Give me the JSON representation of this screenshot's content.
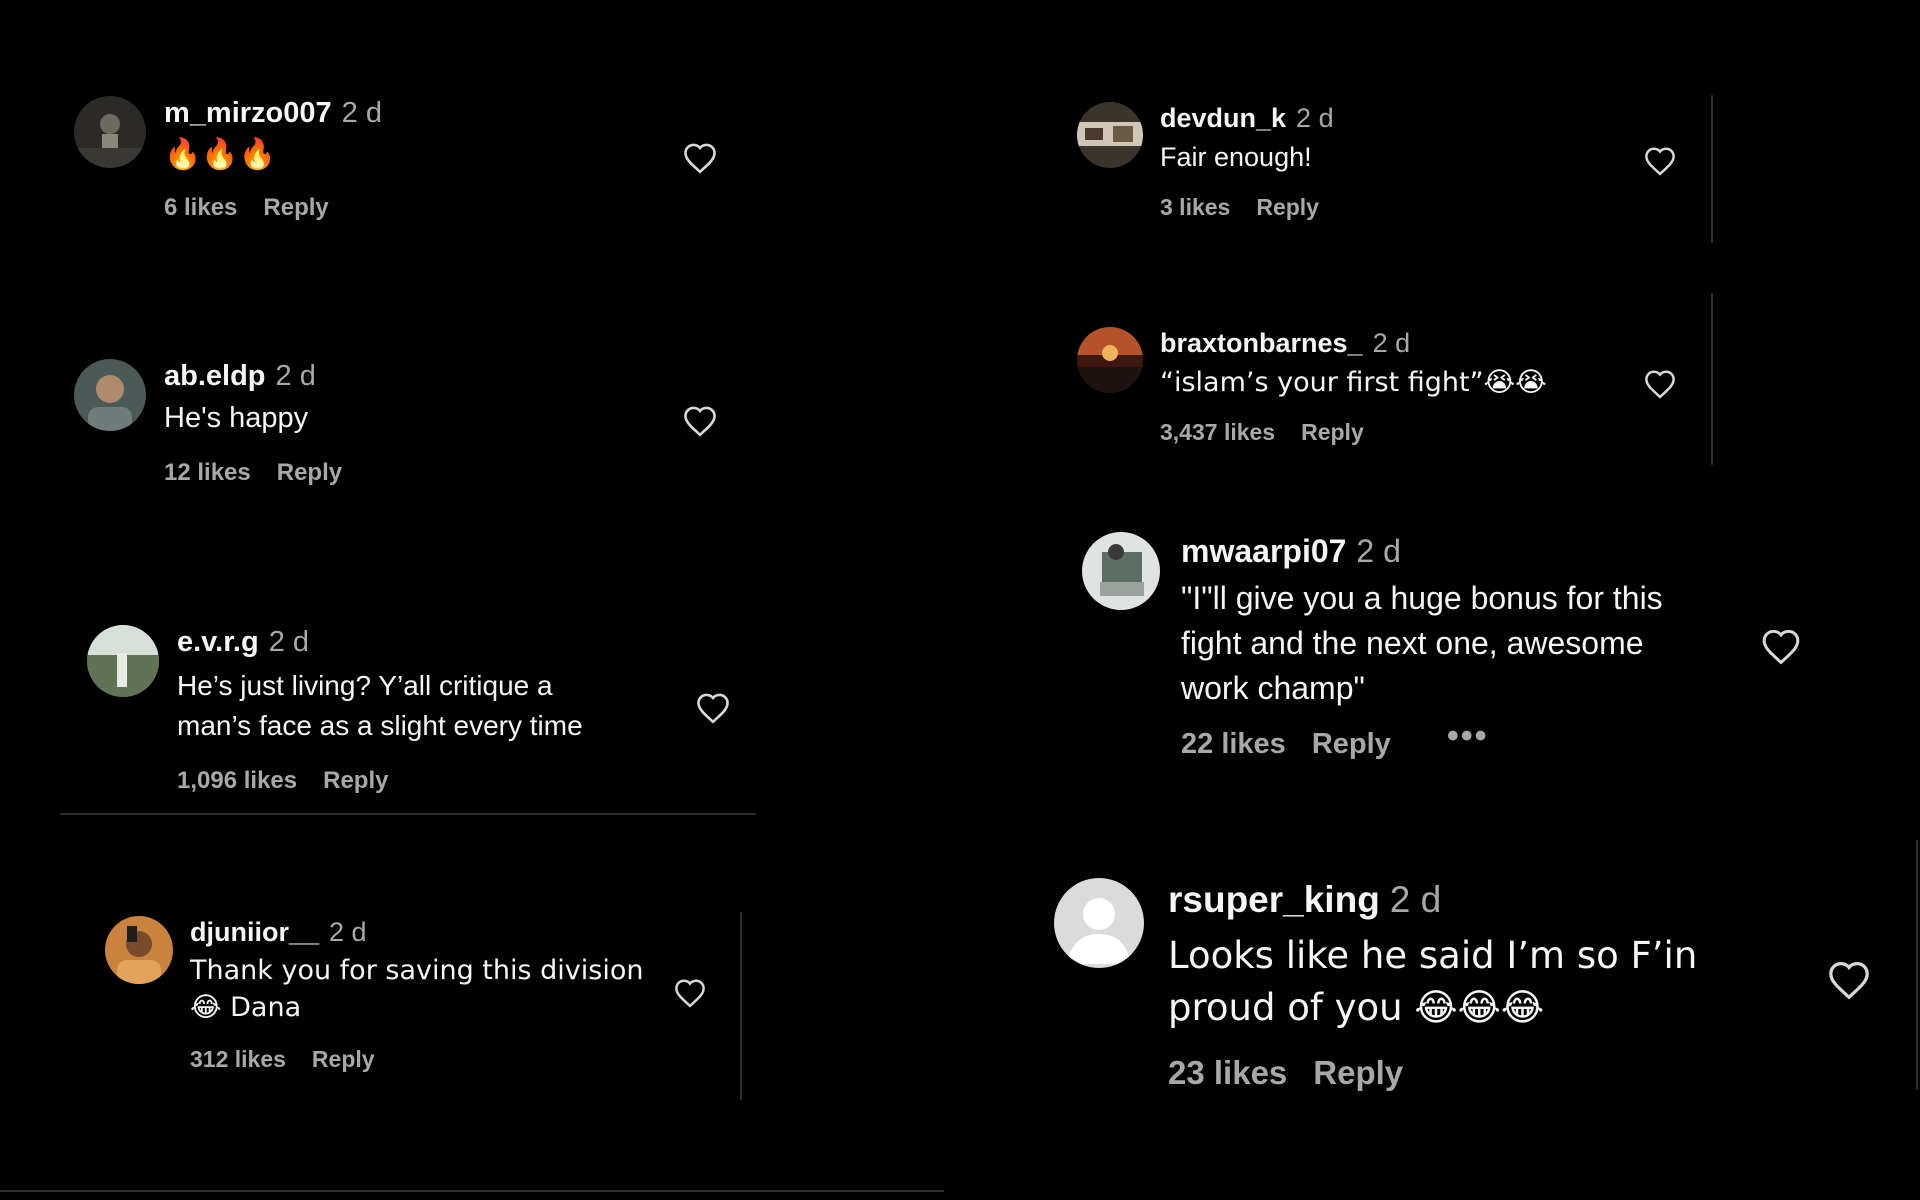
{
  "colors": {
    "background": "#000000",
    "text_primary": "#f5f5f5",
    "text_secondary": "#a8a8a8",
    "divider": "#2e2e2e"
  },
  "comments": [
    {
      "username": "m_mirzo007",
      "time": "2 d",
      "text": "🔥🔥🔥",
      "likes": "6 likes",
      "reply": "Reply",
      "like_icon": "heart-outline-icon"
    },
    {
      "username": "ab.eldp",
      "time": "2 d",
      "text": "He's happy",
      "likes": "12 likes",
      "reply": "Reply",
      "like_icon": "heart-outline-icon"
    },
    {
      "username": "e.v.r.g",
      "time": "2 d",
      "text_lines": [
        "He’s just living? Y’all critique a",
        "man’s face as a slight every time"
      ],
      "likes": "1,096 likes",
      "reply": "Reply",
      "like_icon": "heart-outline-icon"
    },
    {
      "username": "djuniior__",
      "time": "2 d",
      "text_lines": [
        "Thank you for saving this division",
        "😂 Dana"
      ],
      "likes": "312 likes",
      "reply": "Reply",
      "like_icon": "heart-outline-icon"
    },
    {
      "username": "devdun_k",
      "time": "2 d",
      "text": "Fair enough!",
      "likes": "3 likes",
      "reply": "Reply",
      "like_icon": "heart-outline-icon"
    },
    {
      "username": "braxtonbarnes_",
      "time": "2 d",
      "text": "“islam’s your first fight”😭😭",
      "likes": "3,437 likes",
      "reply": "Reply",
      "like_icon": "heart-outline-icon"
    },
    {
      "username": "mwaarpi07",
      "time": "2 d",
      "text_lines": [
        "\"I\"ll give you a huge bonus for this",
        "fight and the next one, awesome",
        "work champ\""
      ],
      "likes": "22 likes",
      "reply": "Reply",
      "more": "•••",
      "like_icon": "heart-outline-icon"
    },
    {
      "username": "rsuper_king",
      "time": "2 d",
      "text_lines": [
        "Looks like he said I’m so F’in",
        "proud of you 😂😂😂"
      ],
      "likes": "23 likes",
      "reply": "Reply",
      "like_icon": "heart-outline-icon"
    }
  ]
}
